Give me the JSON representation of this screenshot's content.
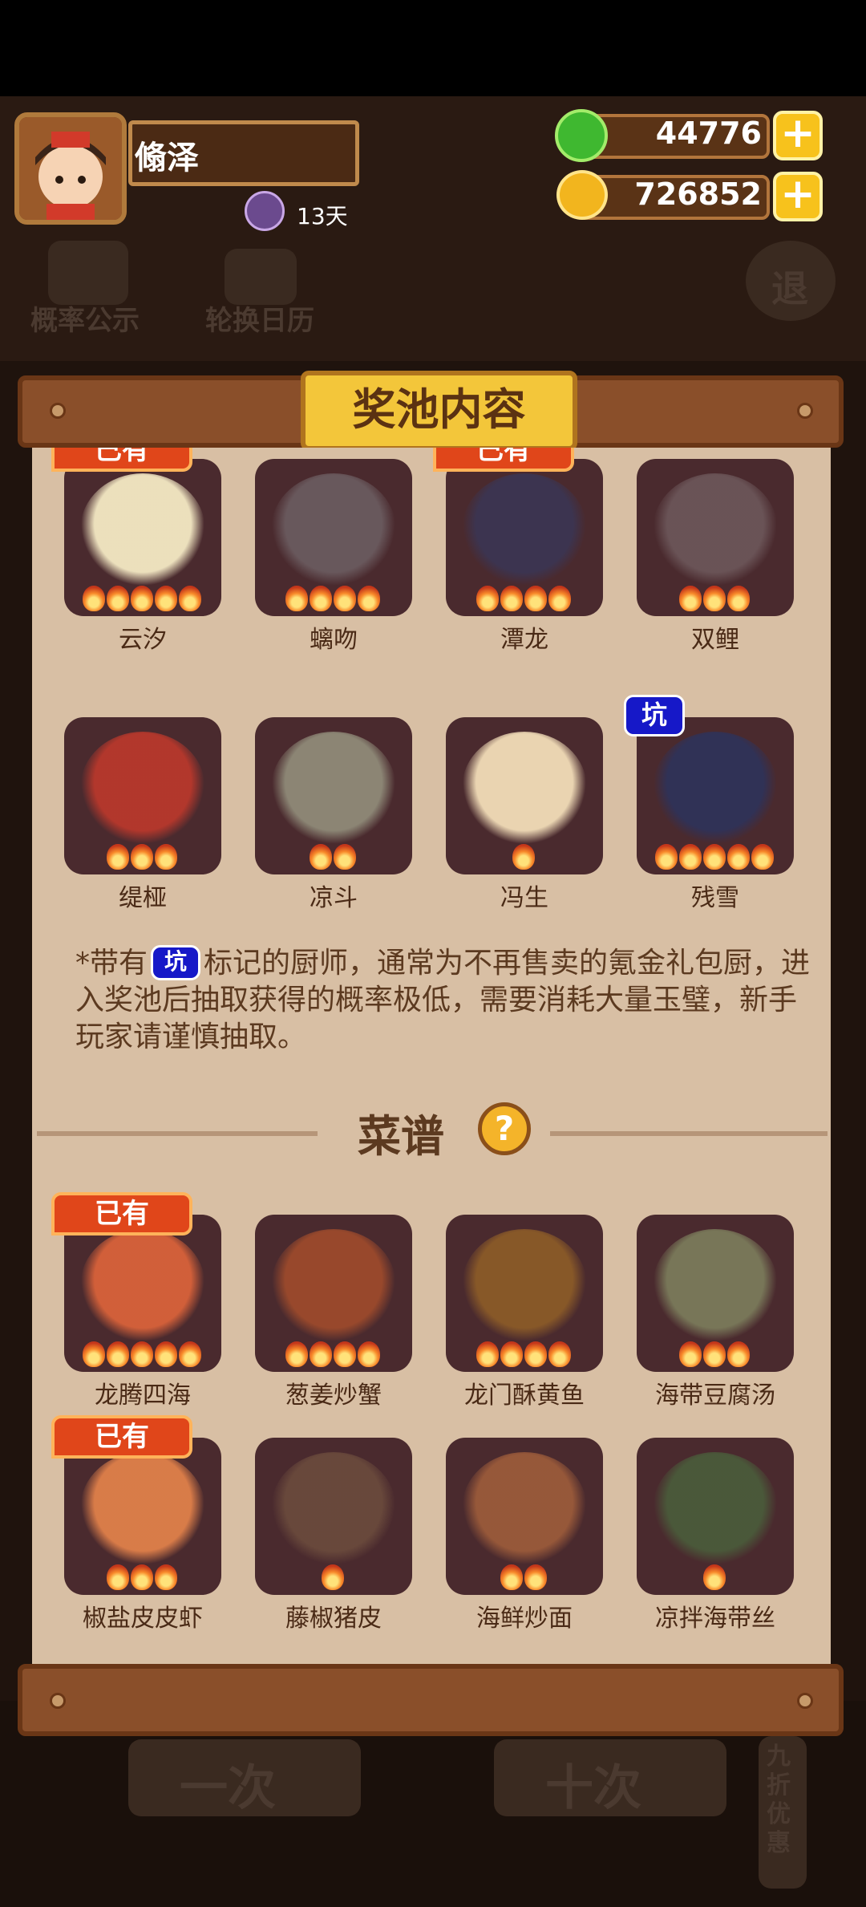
{
  "player": {
    "name": "翛泽",
    "days": "13天"
  },
  "currency": {
    "jade": "44776",
    "coins": "726852"
  },
  "background": {
    "prob_label": "概率公示",
    "calendar_label": "轮换日历",
    "exit_label": "退",
    "single_draw": "一次",
    "ten_draw": "十次",
    "discount": "九折优惠"
  },
  "panel": {
    "title": "奖池内容",
    "chefs": [
      {
        "name": "云汐",
        "stars": 5,
        "owned": true,
        "pit": false,
        "color": "#f4e9c4"
      },
      {
        "name": "螭吻",
        "stars": 4,
        "owned": false,
        "pit": false,
        "color": "#6a5a5e"
      },
      {
        "name": "潭龙",
        "stars": 4,
        "owned": true,
        "pit": false,
        "color": "#3b3552"
      },
      {
        "name": "双鲤",
        "stars": 3,
        "owned": false,
        "pit": false,
        "color": "#6b5558"
      },
      {
        "name": "缇桠",
        "stars": 3,
        "owned": false,
        "pit": false,
        "color": "#b8382c"
      },
      {
        "name": "凉斗",
        "stars": 2,
        "owned": false,
        "pit": false,
        "color": "#8f8a78"
      },
      {
        "name": "冯生",
        "stars": 1,
        "owned": false,
        "pit": false,
        "color": "#f2ddb8"
      },
      {
        "name": "残雪",
        "stars": 5,
        "owned": false,
        "pit": true,
        "color": "#2f3258"
      }
    ],
    "pit_label": "坑",
    "note_prefix": "*带有",
    "note_rest": "标记的厨师，通常为不再售卖的氪金礼包厨，进入奖池后抽取获得的概率极低，需要消耗大量玉璧，新手玩家请谨慎抽取。",
    "recipes_title": "菜谱",
    "help_symbol": "?",
    "owned_label": "已有",
    "recipes": [
      {
        "name": "龙腾四海",
        "stars": 5,
        "owned": true,
        "color": "#d8623a"
      },
      {
        "name": "葱姜炒蟹",
        "stars": 4,
        "owned": false,
        "color": "#9c4a2c"
      },
      {
        "name": "龙门酥黄鱼",
        "stars": 4,
        "owned": false,
        "color": "#8a5a28"
      },
      {
        "name": "海带豆腐汤",
        "stars": 3,
        "owned": false,
        "color": "#7a7a5a"
      },
      {
        "name": "椒盐皮皮虾",
        "stars": 3,
        "owned": true,
        "color": "#e0804a"
      },
      {
        "name": "藤椒猪皮",
        "stars": 1,
        "owned": false,
        "color": "#6a4a3c"
      },
      {
        "name": "海鲜炒面",
        "stars": 2,
        "owned": false,
        "color": "#9a5a3a"
      },
      {
        "name": "凉拌海带丝",
        "stars": 1,
        "owned": false,
        "color": "#4a5a3a"
      }
    ]
  }
}
